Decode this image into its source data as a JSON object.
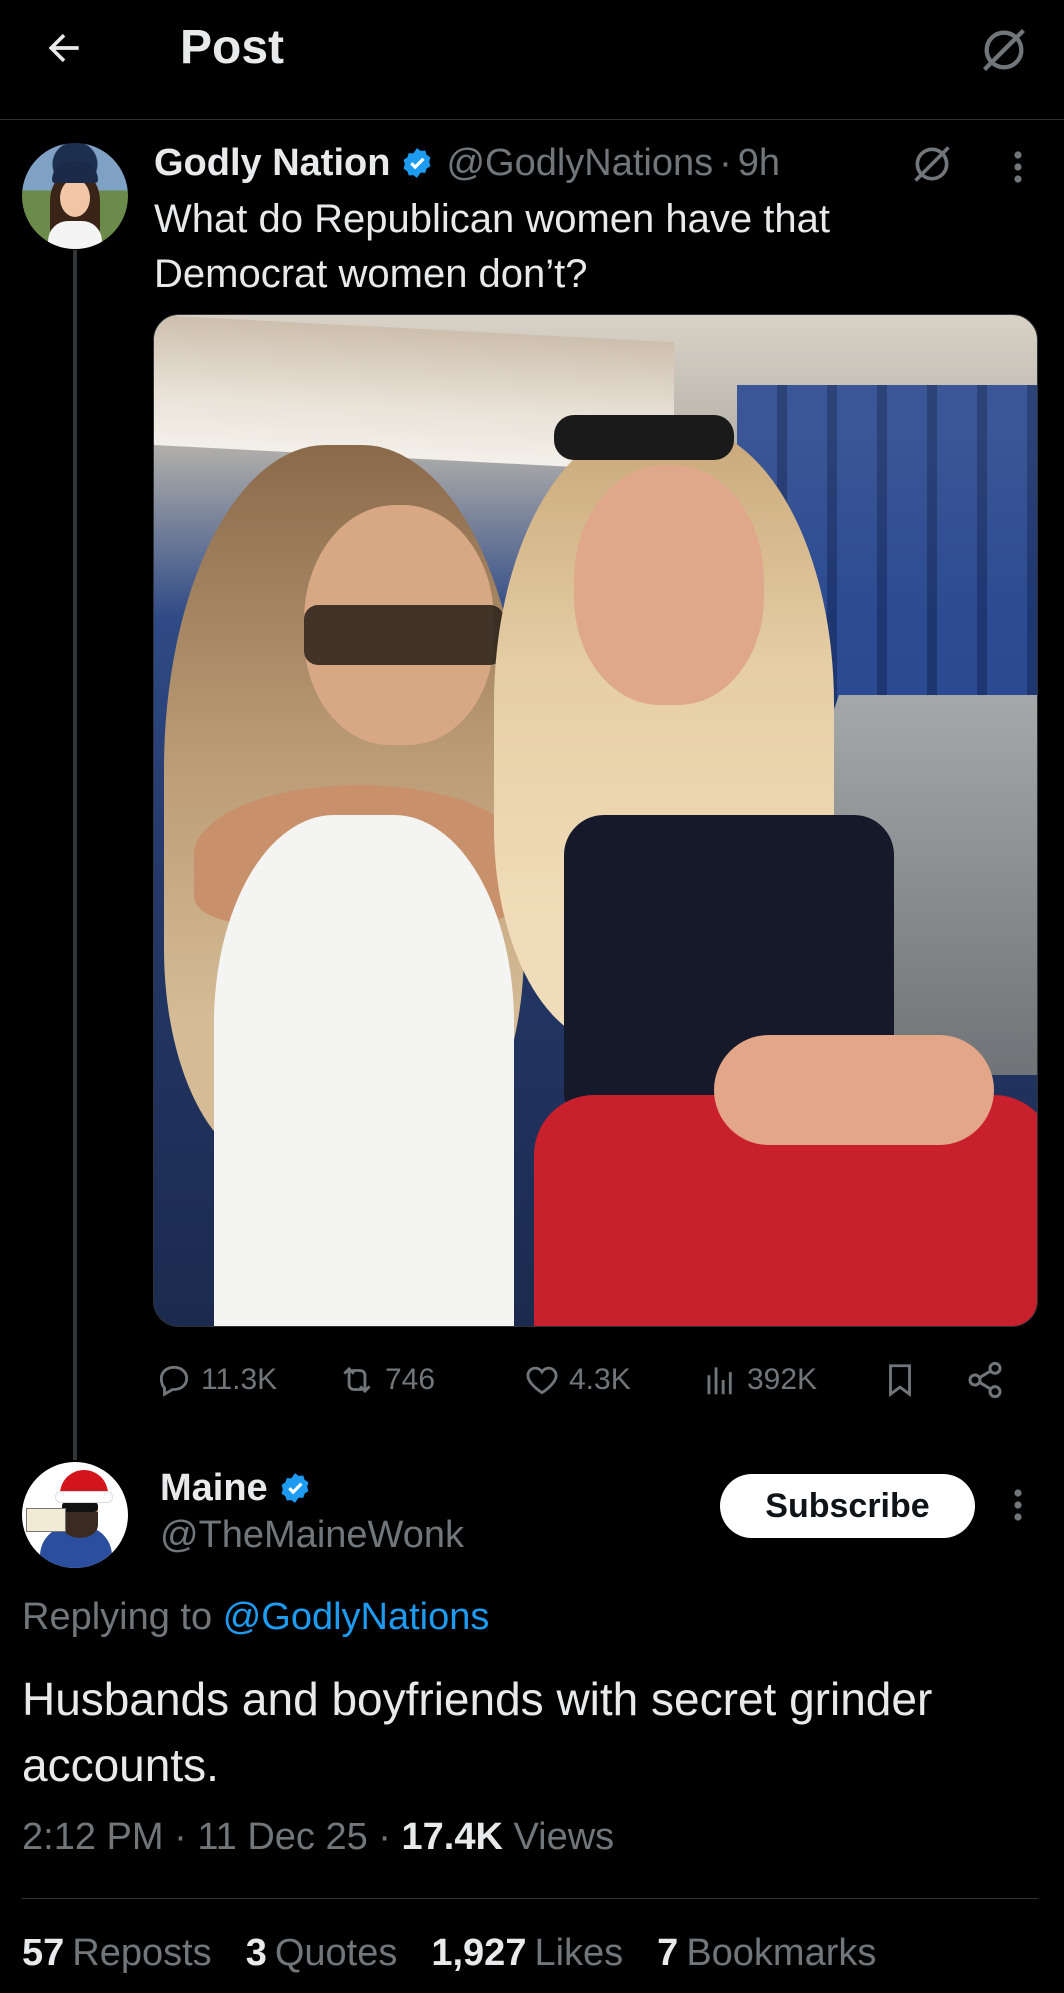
{
  "header": {
    "title": "Post"
  },
  "post": {
    "author_name": "Godly Nation",
    "handle": "@GodlyNations",
    "separator": "·",
    "time": "9h",
    "text": "What do Republican women have that Democrat women don’t?",
    "actions": {
      "replies": "11.3K",
      "reposts": "746",
      "likes": "4.3K",
      "views": "392K"
    }
  },
  "reply": {
    "author_name": "Maine",
    "handle": "@TheMaineWonk",
    "subscribe_label": "Subscribe",
    "replying_prefix": "Replying to",
    "replying_mention": "@GodlyNations",
    "text": "Husbands and boyfriends with secret grinder accounts.",
    "time": "2:12 PM",
    "date": "11 Dec 25",
    "separator": "·",
    "views_count": "17.4K",
    "views_label": "Views",
    "stats": {
      "reposts_count": "57",
      "reposts_label": "Reposts",
      "quotes_count": "3",
      "quotes_label": "Quotes",
      "likes_count": "1,927",
      "likes_label": "Likes",
      "bookmarks_count": "7",
      "bookmarks_label": "Bookmarks"
    }
  },
  "colors": {
    "background": "#000000",
    "text": "#e7e9ea",
    "muted": "#71767b",
    "accent": "#1d9bf0",
    "divider": "#2f3336"
  },
  "icons": [
    "back-arrow-icon",
    "grok-icon",
    "verified-badge-icon",
    "more-icon",
    "reply-icon",
    "repost-icon",
    "like-icon",
    "views-icon",
    "bookmark-icon",
    "share-icon"
  ]
}
